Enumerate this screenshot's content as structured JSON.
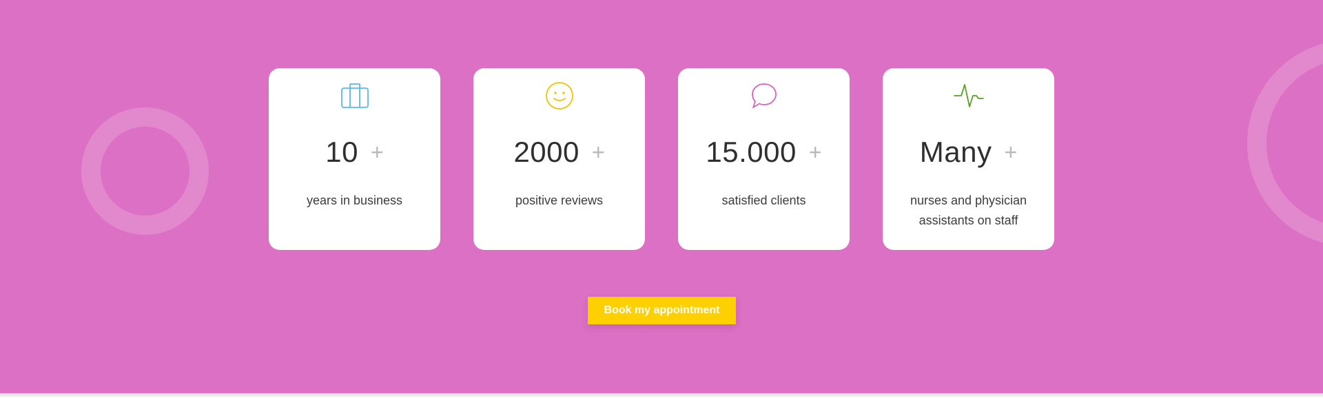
{
  "stats": [
    {
      "icon": "briefcase-icon",
      "icon_color": "#5ab8ef",
      "value": "10",
      "suffix": "+",
      "label": "years in business"
    },
    {
      "icon": "smiley-icon",
      "icon_color": "#f5c200",
      "value": "2000",
      "suffix": "+",
      "label": "positive reviews"
    },
    {
      "icon": "chat-bubble-icon",
      "icon_color": "#d760c0",
      "value": "15.000",
      "suffix": "+",
      "label": "satisfied clients"
    },
    {
      "icon": "heartbeat-icon",
      "icon_color": "#5aa020",
      "value": "Many",
      "suffix": "+",
      "label": "nurses and physician assistants on staff"
    }
  ],
  "cta": {
    "label": "Book my appointment"
  },
  "colors": {
    "background": "#dc70c4",
    "card": "#ffffff",
    "button": "#ffd000"
  }
}
